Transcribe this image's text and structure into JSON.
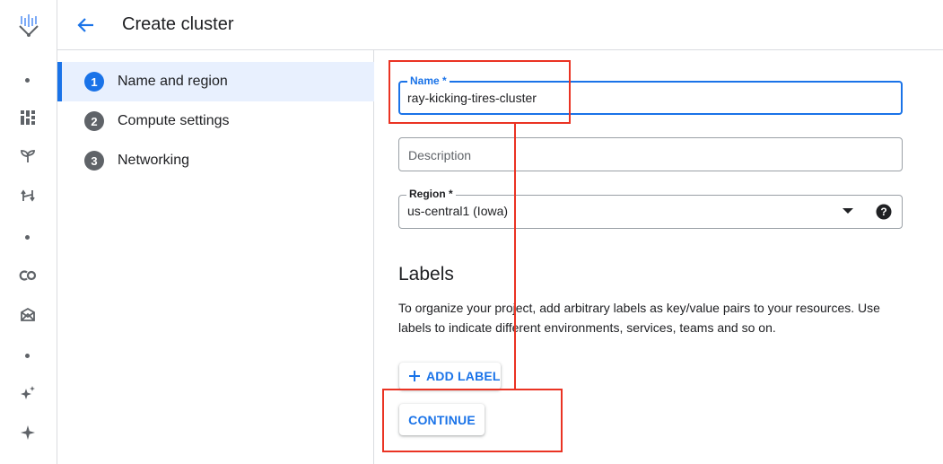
{
  "header": {
    "title": "Create cluster"
  },
  "stepper": {
    "steps": [
      {
        "number": "1",
        "label": "Name and region"
      },
      {
        "number": "2",
        "label": "Compute settings"
      },
      {
        "number": "3",
        "label": "Networking"
      }
    ],
    "active_step": "1"
  },
  "form": {
    "name": {
      "label": "Name *",
      "value": "ray-kicking-tires-cluster"
    },
    "description": {
      "placeholder": "Description"
    },
    "region": {
      "label": "Region *",
      "value": "us-central1 (Iowa)"
    }
  },
  "labels_section": {
    "heading": "Labels",
    "description": "To organize your project, add arbitrary labels as key/value pairs to your resources. Use labels to indicate different environments, services, teams and so on.",
    "add_label_button": "ADD LABEL"
  },
  "actions": {
    "continue_button": "CONTINUE"
  },
  "colors": {
    "accent": "#1a73e8",
    "annotation": "#ea3323",
    "active_step_bg": "#e8f0fe"
  },
  "icons": {
    "back": "arrow-back-icon",
    "help": "help-icon",
    "add": "plus-icon",
    "dropdown": "dropdown-arrow-icon"
  }
}
